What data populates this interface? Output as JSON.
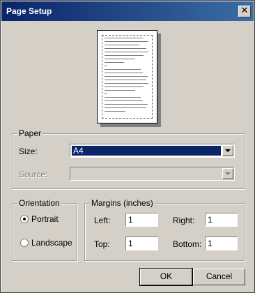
{
  "window": {
    "title": "Page Setup",
    "close_glyph": "✕"
  },
  "paper": {
    "legend": "Paper",
    "size_label": "Size:",
    "size_value": "A4",
    "source_label": "Source:",
    "source_value": ""
  },
  "orientation": {
    "legend": "Orientation",
    "options": [
      {
        "label": "Portrait",
        "selected": true
      },
      {
        "label": "Landscape",
        "selected": false
      }
    ]
  },
  "margins": {
    "legend": "Margins (inches)",
    "left_label": "Left:",
    "left_value": "1",
    "right_label": "Right:",
    "right_value": "1",
    "top_label": "Top:",
    "top_value": "1",
    "bottom_label": "Bottom:",
    "bottom_value": "1"
  },
  "buttons": {
    "ok": "OK",
    "cancel": "Cancel"
  }
}
